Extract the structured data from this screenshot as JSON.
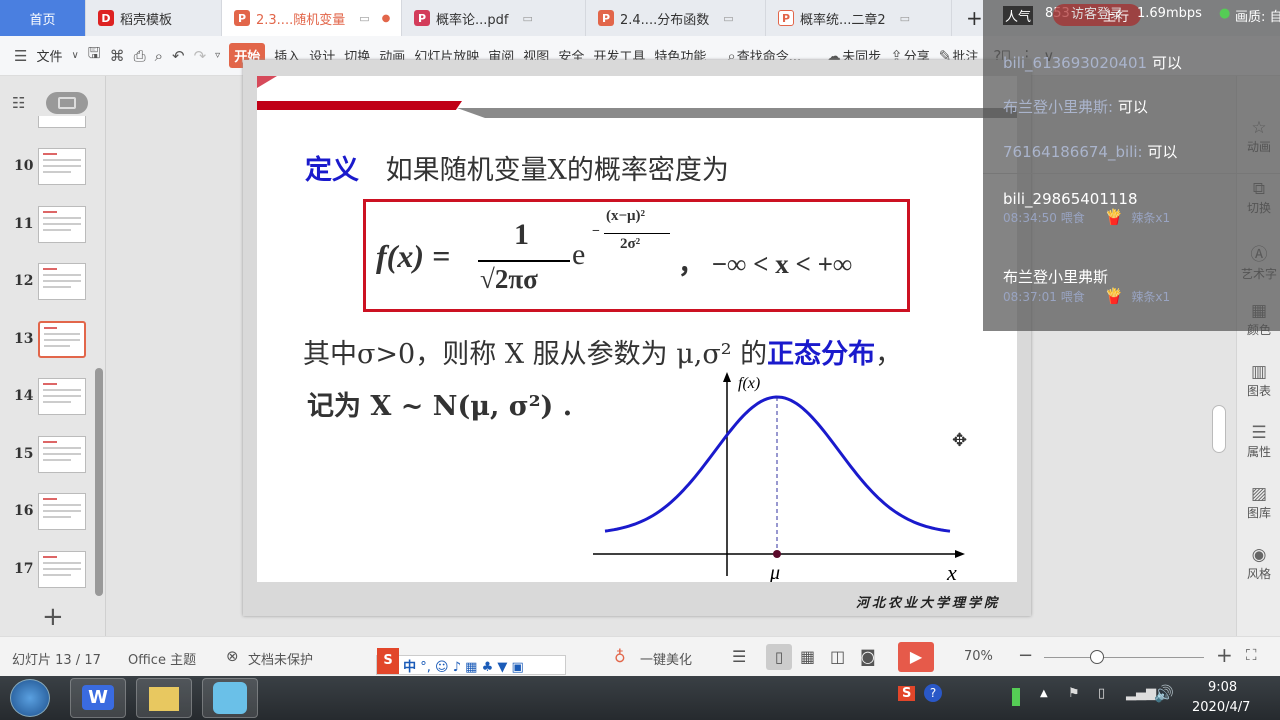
{
  "tabs": [
    {
      "label": "首页"
    },
    {
      "label": "稻壳模板"
    },
    {
      "label": "2.3....随机变量"
    },
    {
      "label": "概率论...pdf"
    },
    {
      "label": "2.4....分布函数"
    },
    {
      "label": "概率统...二章2"
    }
  ],
  "new_tab": "+",
  "stream": {
    "popularity_label": "人气",
    "popularity": "853",
    "visitor_login": "访客登录",
    "upload_label": "上行",
    "upload_speed": "1.69mbps",
    "quality_label": "画质: 自"
  },
  "toolbar": {
    "menu": "文件",
    "items": [
      "开始",
      "插入",
      "设计",
      "切换",
      "动画",
      "幻灯片放映",
      "审阅",
      "视图",
      "安全",
      "开发工具",
      "特色功能"
    ],
    "search": "查找命令...",
    "cloud_sync": "未同步",
    "share": "分享",
    "annotate": "批注"
  },
  "chat": [
    {
      "user": "bili_613693020401",
      "text": "可以"
    },
    {
      "user": "布兰登小里弗斯:",
      "text": "可以"
    },
    {
      "user": "76164186674_bili:",
      "text": "可以"
    },
    {
      "user": "bili_29865401118",
      "time": "08:34:50 喂食",
      "gift": "辣条x1"
    },
    {
      "user": "布兰登小里弗斯",
      "time": "08:37:01 喂食",
      "gift": "辣条x1"
    }
  ],
  "thumbnails": [
    {
      "num": "10"
    },
    {
      "num": "11"
    },
    {
      "num": "12"
    },
    {
      "num": "13"
    },
    {
      "num": "14"
    },
    {
      "num": "15"
    },
    {
      "num": "16"
    },
    {
      "num": "17"
    }
  ],
  "selected_slide": "13",
  "slide": {
    "def_label": "定义",
    "def_text": "如果随机变量X的概率密度为",
    "formula_lhs": "f(x) =",
    "formula_num": "1",
    "formula_den": "√2πσ",
    "formula_e": "e",
    "exp_num": "(x−μ)²",
    "exp_den": "2σ²",
    "formula_domain": "，  −∞ < x < +∞",
    "line2_a": "其中σ>0，则称 X 服从参数为 μ,σ² 的",
    "line2_b": "正态分布",
    "line2_c": "，",
    "line3": "记为  X ~ N(μ, σ²) .",
    "graph_ylabel": "f(x)",
    "graph_mu": "μ",
    "graph_x": "x",
    "footer": "河北农业大学理学院"
  },
  "rightbar": [
    "动画",
    "切换",
    "艺术字",
    "颜色",
    "图表",
    "属性",
    "图库",
    "风格"
  ],
  "status": {
    "slide_counter": "幻灯片 13 / 17",
    "theme": "Office 主题",
    "protect": "文档未保护",
    "beautify": "一键美化",
    "zoom": "70%",
    "ime": "中"
  },
  "taskbar": {
    "time": "9:08",
    "date": "2020/4/7"
  },
  "colors": {
    "accent": "#e2664a",
    "home_tab": "#4a7fe0",
    "curve": "#1a1acc",
    "frame": "#cc1122",
    "def_blue": "#1a1acc"
  }
}
